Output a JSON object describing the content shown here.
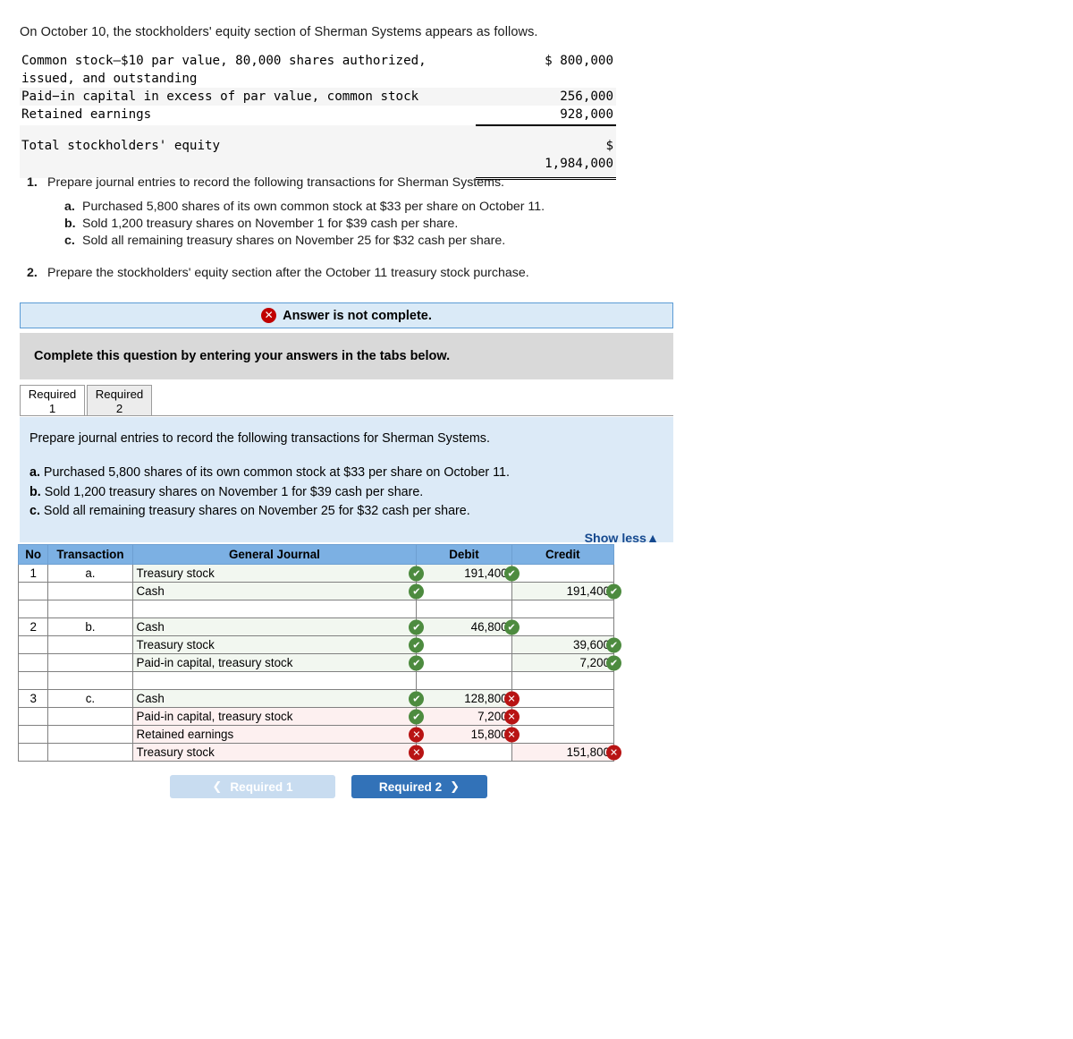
{
  "intro": "On October 10, the stockholders' equity section of Sherman Systems appears as follows.",
  "equity": {
    "rows": [
      {
        "label": "Common stock—$10 par value, 80,000 shares authorized,\nissued, and outstanding",
        "amount": "$ 800,000"
      },
      {
        "label": "Paid−in capital in excess of par value, common stock",
        "amount": "256,000"
      },
      {
        "label": "Retained earnings",
        "amount": "928,000"
      }
    ],
    "total_label": "Total stockholders' equity",
    "total_amount": "$\n1,984,000"
  },
  "requirements": [
    {
      "num": "1.",
      "text": "Prepare journal entries to record the following transactions for Sherman Systems."
    },
    {
      "num": "2.",
      "text": "Prepare the stockholders' equity section after the October 11 treasury stock purchase."
    }
  ],
  "transactions": [
    {
      "letter": "a.",
      "text": "Purchased 5,800 shares of its own common stock at $33 per share on October 11."
    },
    {
      "letter": "b.",
      "text": "Sold 1,200 treasury shares on November 1 for $39 cash per share."
    },
    {
      "letter": "c.",
      "text": "Sold all remaining treasury shares on November 25 for $32 cash per share."
    }
  ],
  "alert": {
    "icon": "x-circle-icon",
    "message": "Answer is not complete."
  },
  "gray_band": {
    "message": "Complete this question by entering your answers in the tabs below."
  },
  "tabs": [
    {
      "line1": "Required",
      "line2": "1",
      "active": true
    },
    {
      "line1": "Required",
      "line2": "2",
      "active": false
    }
  ],
  "info_panel": {
    "lead": "Prepare journal entries to record the following transactions for Sherman Systems.",
    "show_less": "Show less",
    "show_less_icon": "caret-up-icon"
  },
  "journal": {
    "headers": [
      "No",
      "Transaction",
      "General Journal",
      "Debit",
      "Credit"
    ],
    "rows": [
      {
        "no": "1",
        "transaction": "a.",
        "account": "Treasury stock",
        "indent": 0,
        "debit": "191,400",
        "credit": "",
        "acct_mark": "ok",
        "amt_mark": "ok",
        "state": "ok"
      },
      {
        "no": "",
        "transaction": "",
        "account": "Cash",
        "indent": 1,
        "debit": "",
        "credit": "191,400",
        "acct_mark": "ok",
        "amt_mark": "ok",
        "state": "ok"
      },
      {
        "no": "",
        "transaction": "",
        "account": "",
        "indent": 0,
        "debit": "",
        "credit": "",
        "acct_mark": "",
        "amt_mark": "",
        "state": "blank"
      },
      {
        "no": "2",
        "transaction": "b.",
        "account": "Cash",
        "indent": 0,
        "debit": "46,800",
        "credit": "",
        "acct_mark": "ok",
        "amt_mark": "ok",
        "state": "ok"
      },
      {
        "no": "",
        "transaction": "",
        "account": "Treasury stock",
        "indent": 1,
        "debit": "",
        "credit": "39,600",
        "acct_mark": "ok",
        "amt_mark": "ok",
        "state": "ok"
      },
      {
        "no": "",
        "transaction": "",
        "account": "Paid-in capital, treasury stock",
        "indent": 1,
        "debit": "",
        "credit": "7,200",
        "acct_mark": "ok",
        "amt_mark": "ok",
        "state": "ok"
      },
      {
        "no": "",
        "transaction": "",
        "account": "",
        "indent": 0,
        "debit": "",
        "credit": "",
        "acct_mark": "",
        "amt_mark": "",
        "state": "blank"
      },
      {
        "no": "3",
        "transaction": "c.",
        "account": "Cash",
        "indent": 0,
        "debit": "128,800",
        "credit": "",
        "acct_mark": "ok",
        "amt_mark": "bad",
        "state": "ok"
      },
      {
        "no": "",
        "transaction": "",
        "account": "Paid-in capital, treasury stock",
        "indent": 0,
        "debit": "7,200",
        "credit": "",
        "acct_mark": "ok",
        "amt_mark": "bad",
        "state": "bad"
      },
      {
        "no": "",
        "transaction": "",
        "account": "Retained earnings",
        "indent": 0,
        "debit": "15,800",
        "credit": "",
        "acct_mark": "bad",
        "amt_mark": "bad",
        "state": "bad"
      },
      {
        "no": "",
        "transaction": "",
        "account": "Treasury stock",
        "indent": 1,
        "debit": "",
        "credit": "151,800",
        "acct_mark": "bad",
        "amt_mark": "bad",
        "state": "bad"
      }
    ]
  },
  "nav": {
    "prev_label": "Required 1",
    "next_label": "Required 2",
    "prev_icon": "chevron-left-icon",
    "next_icon": "chevron-right-icon"
  },
  "colors": {
    "header_blue": "#7cb0e3",
    "panel_blue": "#dceaf7",
    "alert_blue": "#daeaf7",
    "alert_border": "#5b9bd5",
    "gray_band": "#d9d9d9",
    "ok_green": "#4d8b3f",
    "bad_red": "#b81414",
    "next_button": "#3272b8",
    "prev_button": "#c8dcf0",
    "link_blue": "#15498f"
  }
}
